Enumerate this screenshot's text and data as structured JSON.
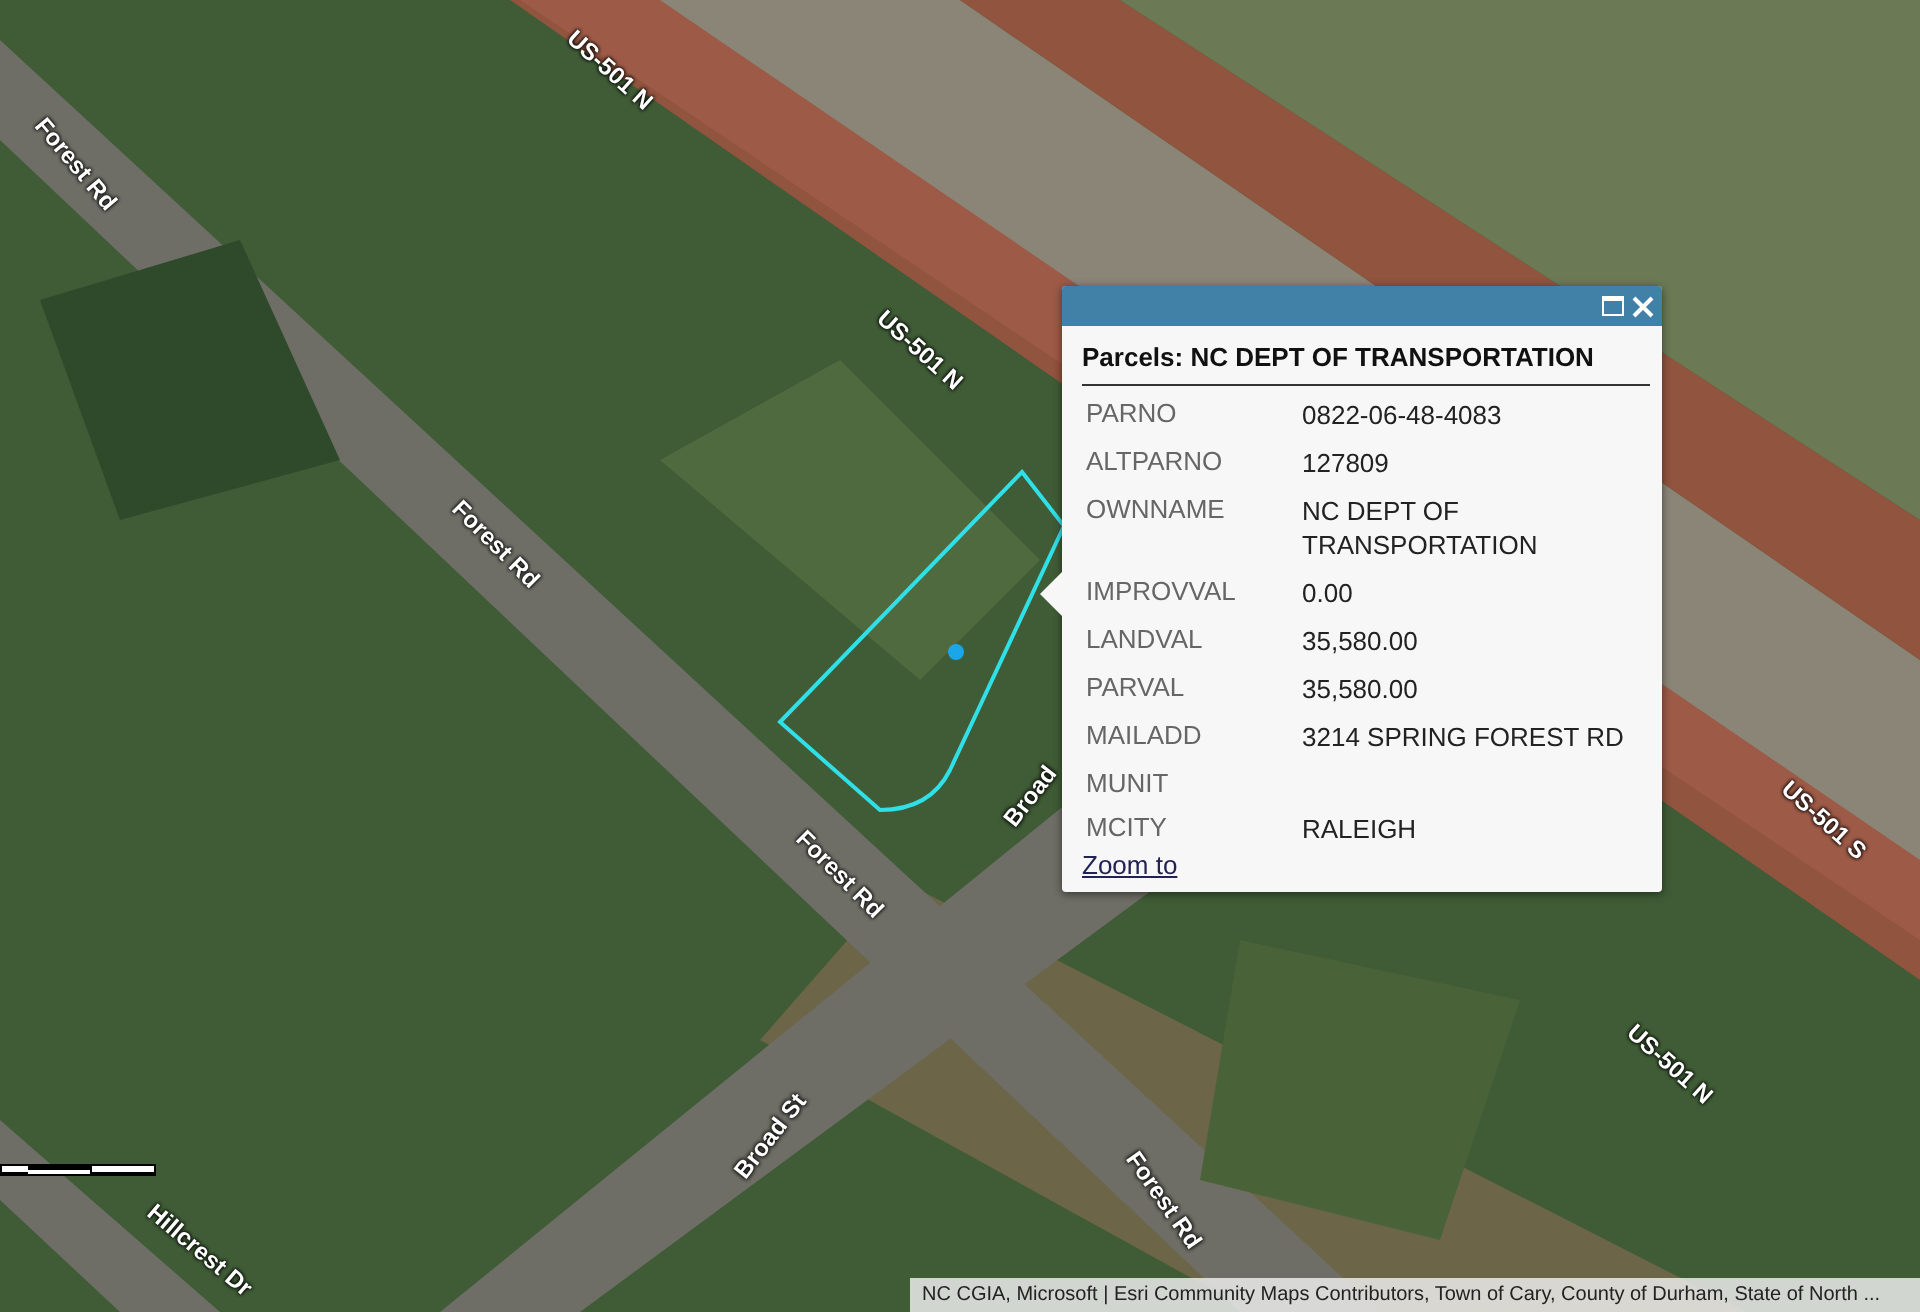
{
  "map": {
    "road_labels": [
      {
        "text": "Forest Rd"
      },
      {
        "text": "US-501 N"
      },
      {
        "text": "US-501 N"
      },
      {
        "text": "Forest Rd"
      },
      {
        "text": "Forest Rd"
      },
      {
        "text": "Broad"
      },
      {
        "text": "Broad St"
      },
      {
        "text": "Forest Rd"
      },
      {
        "text": "US-501 S"
      },
      {
        "text": "US-501 N"
      },
      {
        "text": "Hillcrest Dr"
      }
    ],
    "attribution": "NC CGIA, Microsoft | Esri Community Maps Contributors, Town of Cary, County of Durham, State of North ..."
  },
  "popup": {
    "title": "Parcels: NC DEPT OF TRANSPORTATION",
    "fields": [
      {
        "name": "PARNO",
        "value": "0822-06-48-4083"
      },
      {
        "name": "ALTPARNO",
        "value": "127809"
      },
      {
        "name": "OWNNAME",
        "value": "NC DEPT OF TRANSPORTATION"
      },
      {
        "name": "IMPROVVAL",
        "value": "0.00"
      },
      {
        "name": "LANDVAL",
        "value": "35,580.00"
      },
      {
        "name": "PARVAL",
        "value": "35,580.00"
      },
      {
        "name": "MAILADD",
        "value": "3214 SPRING FOREST RD"
      },
      {
        "name": "MUNIT"
      },
      {
        "name": "MCITY",
        "value": "RALEIGH"
      }
    ],
    "link": "Zoom to"
  }
}
